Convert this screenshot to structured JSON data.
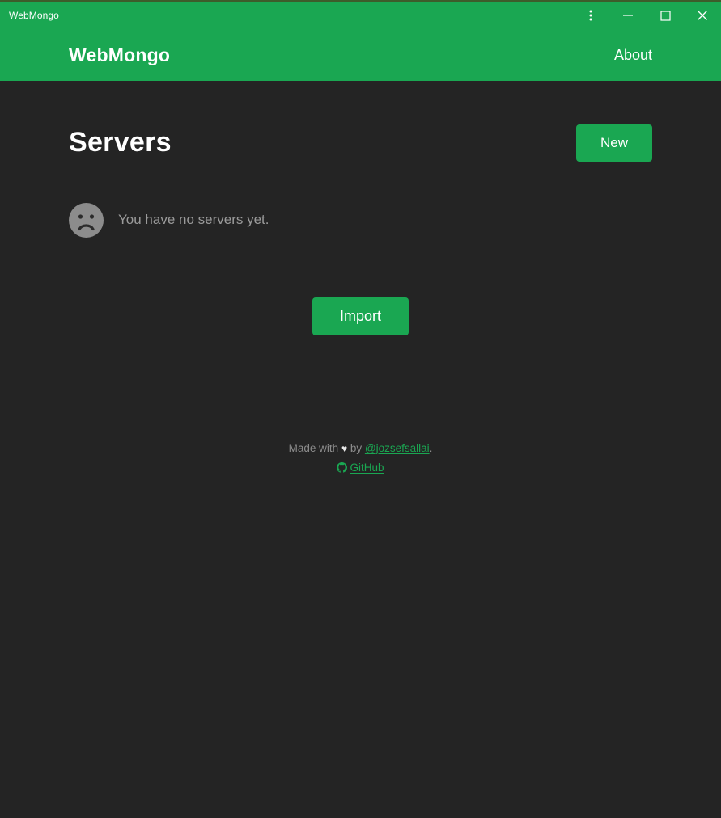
{
  "window": {
    "title": "WebMongo",
    "controls": [
      {
        "name": "kebab-menu",
        "label": "⋮"
      },
      {
        "name": "minimize",
        "label": "—"
      },
      {
        "name": "maximize",
        "label": "□"
      },
      {
        "name": "close",
        "label": "✕"
      }
    ]
  },
  "header": {
    "brand": "WebMongo",
    "about_label": "About"
  },
  "page": {
    "title": "Servers",
    "new_button_label": "New"
  },
  "empty_state": {
    "icon": "sad-face-icon",
    "message": "You have no servers yet."
  },
  "import": {
    "label": "Import"
  },
  "footer": {
    "made_with_prefix": "Made with",
    "heart": "♥",
    "by": "by",
    "author_handle": "@jozsefsallai",
    "period": ".",
    "github_label": "GitHub",
    "github_icon": "github-icon"
  },
  "colors": {
    "accent_green": "#1aa752",
    "background_dark": "#242424",
    "muted_text": "#8c8c8c",
    "titlebar_top_border": "#3d5c2b"
  }
}
